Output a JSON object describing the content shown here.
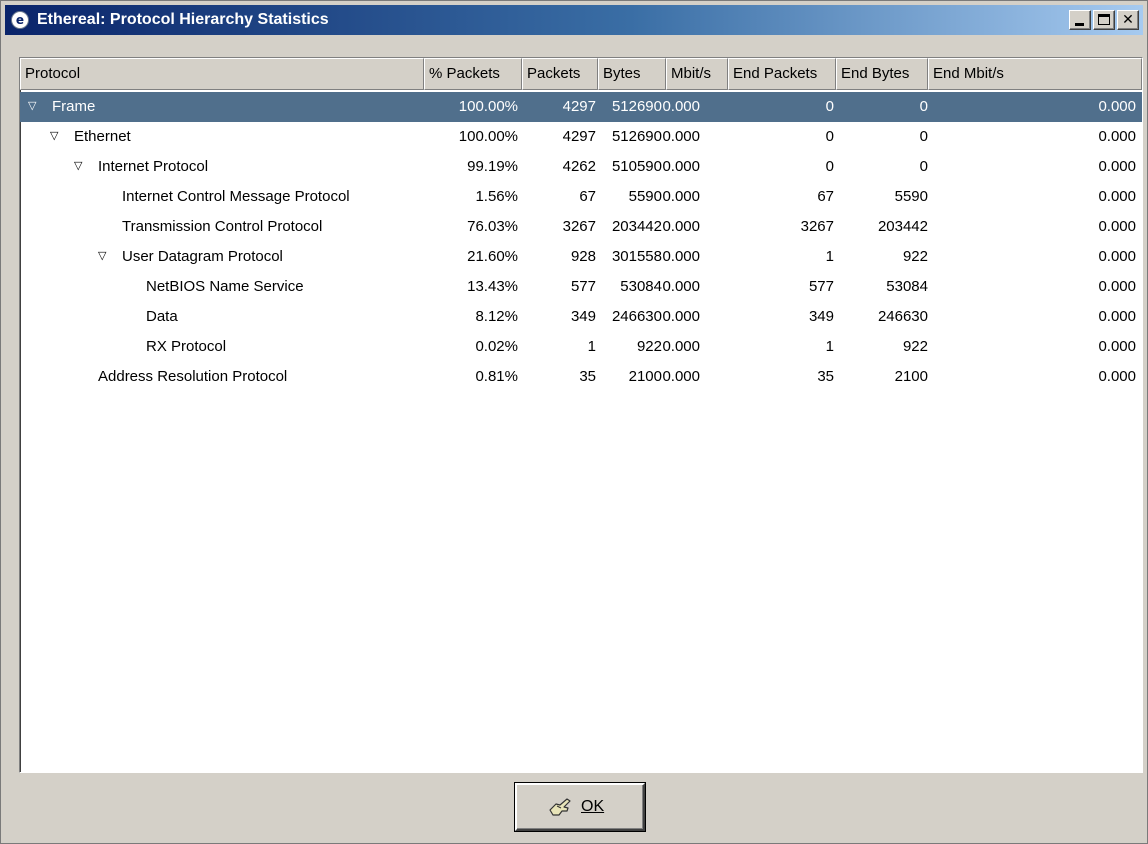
{
  "window": {
    "title": "Ethereal: Protocol Hierarchy Statistics",
    "icon": "ethereal-app-icon"
  },
  "columns": [
    "Protocol",
    "% Packets",
    "Packets",
    "Bytes",
    "Mbit/s",
    "End Packets",
    "End Bytes",
    "End Mbit/s"
  ],
  "rows": [
    {
      "level": 0,
      "expander": "▽",
      "protocol": "Frame",
      "pct_packets": "100.00%",
      "packets": "4297",
      "bytes": "512690",
      "mbits": "0.000",
      "end_packets": "0",
      "end_bytes": "0",
      "end_mbits": "0.000"
    },
    {
      "level": 1,
      "expander": "▽",
      "protocol": "Ethernet",
      "pct_packets": "100.00%",
      "packets": "4297",
      "bytes": "512690",
      "mbits": "0.000",
      "end_packets": "0",
      "end_bytes": "0",
      "end_mbits": "0.000"
    },
    {
      "level": 2,
      "expander": "▽",
      "protocol": "Internet Protocol",
      "pct_packets": "99.19%",
      "packets": "4262",
      "bytes": "510590",
      "mbits": "0.000",
      "end_packets": "0",
      "end_bytes": "0",
      "end_mbits": "0.000"
    },
    {
      "level": 3,
      "expander": "",
      "protocol": "Internet Control Message Protocol",
      "pct_packets": "1.56%",
      "packets": "67",
      "bytes": "5590",
      "mbits": "0.000",
      "end_packets": "67",
      "end_bytes": "5590",
      "end_mbits": "0.000"
    },
    {
      "level": 3,
      "expander": "",
      "protocol": "Transmission Control Protocol",
      "pct_packets": "76.03%",
      "packets": "3267",
      "bytes": "203442",
      "mbits": "0.000",
      "end_packets": "3267",
      "end_bytes": "203442",
      "end_mbits": "0.000"
    },
    {
      "level": 3,
      "expander": "▽",
      "protocol": "User Datagram Protocol",
      "pct_packets": "21.60%",
      "packets": "928",
      "bytes": "301558",
      "mbits": "0.000",
      "end_packets": "1",
      "end_bytes": "922",
      "end_mbits": "0.000"
    },
    {
      "level": 4,
      "expander": "",
      "protocol": "NetBIOS Name Service",
      "pct_packets": "13.43%",
      "packets": "577",
      "bytes": "53084",
      "mbits": "0.000",
      "end_packets": "577",
      "end_bytes": "53084",
      "end_mbits": "0.000"
    },
    {
      "level": 4,
      "expander": "",
      "protocol": "Data",
      "pct_packets": "8.12%",
      "packets": "349",
      "bytes": "246630",
      "mbits": "0.000",
      "end_packets": "349",
      "end_bytes": "246630",
      "end_mbits": "0.000"
    },
    {
      "level": 4,
      "expander": "",
      "protocol": "RX Protocol",
      "pct_packets": "0.02%",
      "packets": "1",
      "bytes": "922",
      "mbits": "0.000",
      "end_packets": "1",
      "end_bytes": "922",
      "end_mbits": "0.000"
    },
    {
      "level": 2,
      "expander": "",
      "protocol": "Address Resolution Protocol",
      "pct_packets": "0.81%",
      "packets": "35",
      "bytes": "2100",
      "mbits": "0.000",
      "end_packets": "35",
      "end_bytes": "2100",
      "end_mbits": "0.000"
    }
  ],
  "selected_row": 0,
  "ok_button": {
    "label": "OK",
    "icon": "ok-hand-icon"
  },
  "colors": {
    "selection": "#506f8c",
    "title_bar": "#0a246a",
    "face": "#d4d0c8"
  }
}
